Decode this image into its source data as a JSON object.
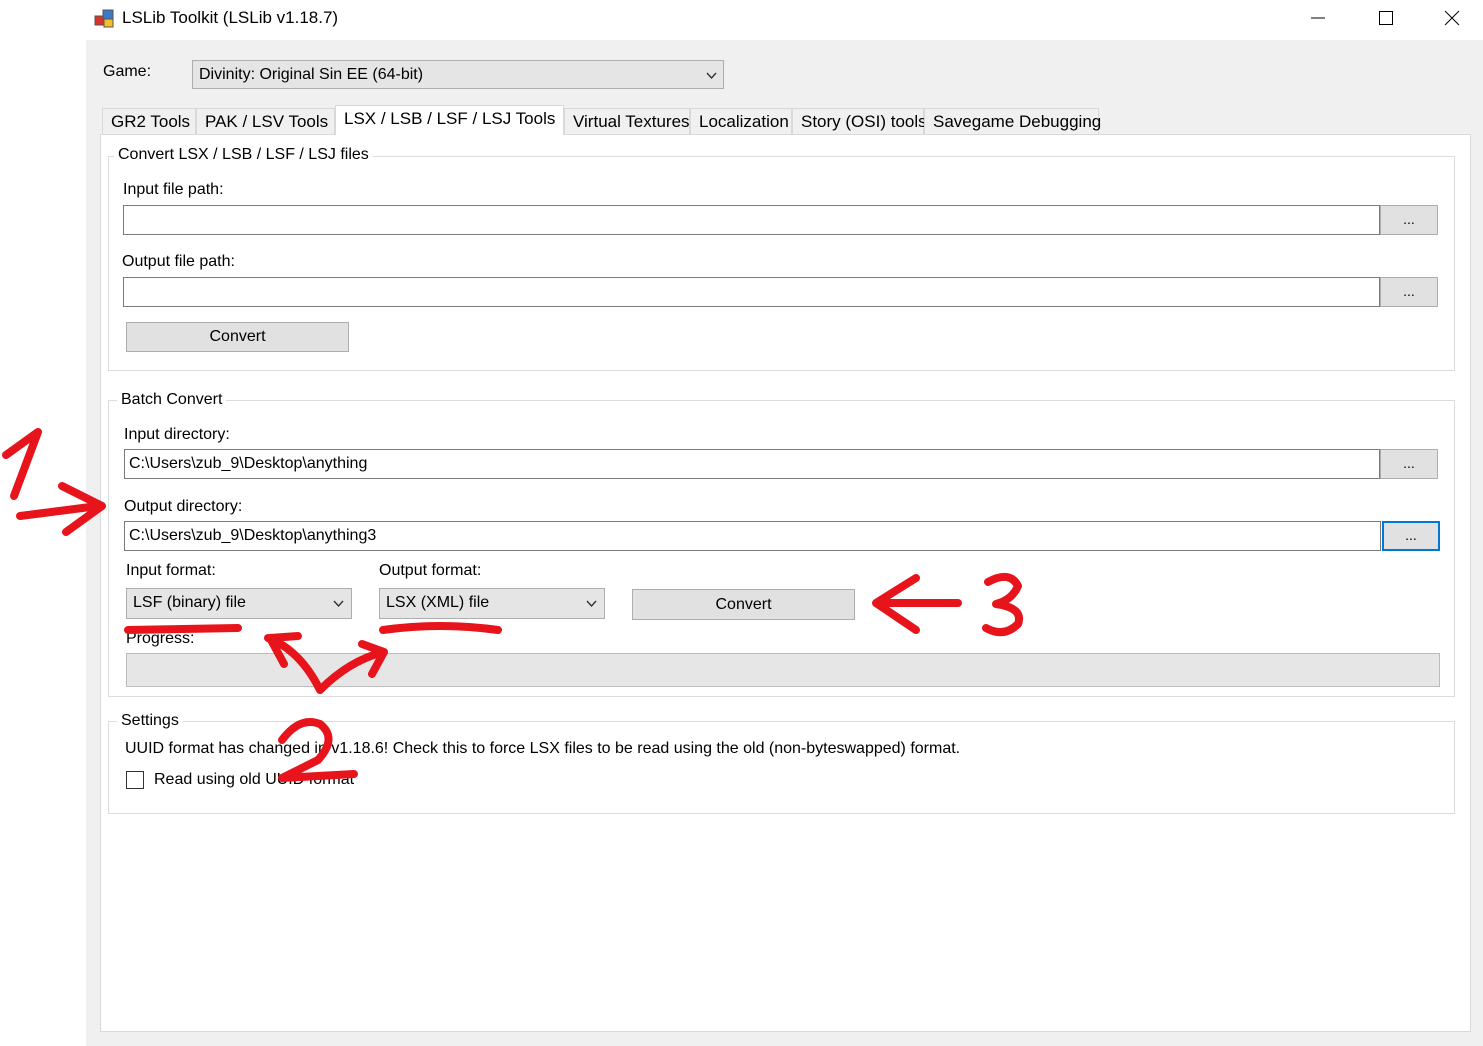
{
  "window": {
    "title": "LSLib Toolkit (LSLib v1.18.7)",
    "controls": {
      "minimize": "—",
      "maximize": "☐",
      "close": "✕"
    }
  },
  "game": {
    "label": "Game:",
    "selected": "Divinity: Original Sin EE (64-bit)"
  },
  "tabs": [
    {
      "label": "GR2 Tools"
    },
    {
      "label": "PAK / LSV Tools"
    },
    {
      "label": "LSX / LSB / LSF / LSJ Tools",
      "active": true
    },
    {
      "label": "Virtual Textures"
    },
    {
      "label": "Localization"
    },
    {
      "label": "Story (OSI) tools"
    },
    {
      "label": "Savegame Debugging"
    }
  ],
  "convert_group": {
    "legend": "Convert LSX / LSB / LSF / LSJ files",
    "input_label": "Input file path:",
    "input_value": "",
    "output_label": "Output file path:",
    "output_value": "",
    "browse_label": "...",
    "convert_label": "Convert"
  },
  "batch_group": {
    "legend": "Batch Convert",
    "input_dir_label": "Input directory:",
    "input_dir_value": "C:\\Users\\zub_9\\Desktop\\anything",
    "output_dir_label": "Output directory:",
    "output_dir_value": "C:\\Users\\zub_9\\Desktop\\anything3",
    "browse_label": "...",
    "input_format_label": "Input format:",
    "input_format_value": "LSF (binary) file",
    "output_format_label": "Output format:",
    "output_format_value": "LSX (XML) file",
    "convert_label": "Convert",
    "progress_label": "Progress:",
    "progress": 0
  },
  "settings_group": {
    "legend": "Settings",
    "note": "UUID format has changed in v1.18.6! Check this to force LSX files to be read using the old (non-byteswapped) format.",
    "checkbox_label": "Read using old UUID format",
    "checked": false
  },
  "annotations": {
    "color": "#e8141c",
    "marker_1": "1",
    "marker_2": "2",
    "marker_3": "3"
  }
}
